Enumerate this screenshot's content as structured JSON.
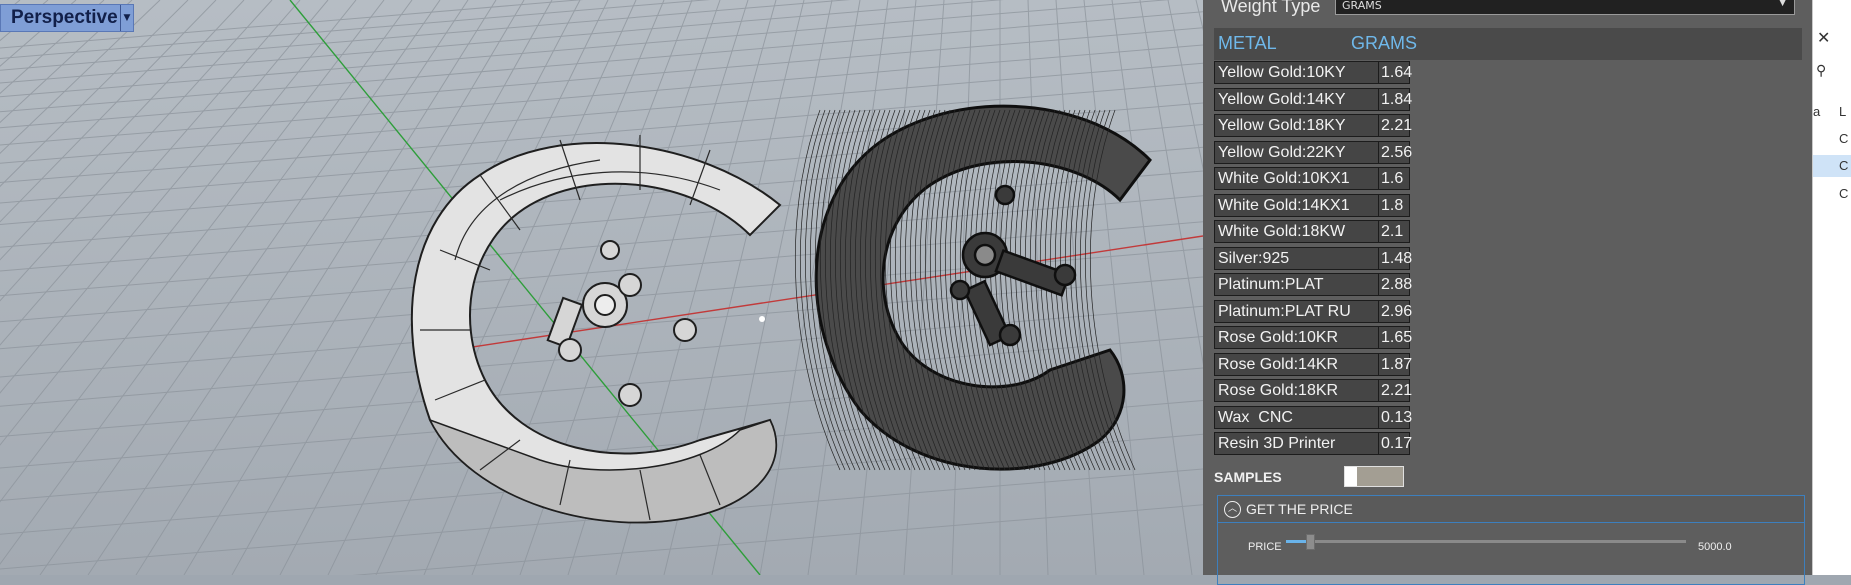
{
  "viewport": {
    "title": "Perspective",
    "background_color": "#aab1b9",
    "grid_color": "#8d949c",
    "x_axis_color": "#c23a3a",
    "y_axis_color": "#2e9e3a",
    "objects": [
      "render-mode-ring",
      "wireframe-ring"
    ]
  },
  "panel": {
    "weight_type_label": "Weight Type",
    "weight_type_value": "GRAMS",
    "header": {
      "metal": "METAL",
      "grams": "GRAMS"
    },
    "rows": [
      {
        "metal": "Yellow Gold:10KY",
        "grams": "1.64"
      },
      {
        "metal": "Yellow Gold:14KY",
        "grams": "1.84"
      },
      {
        "metal": "Yellow Gold:18KY",
        "grams": "2.21"
      },
      {
        "metal": "Yellow Gold:22KY",
        "grams": "2.56"
      },
      {
        "metal": "White Gold:10KX1",
        "grams": "1.6"
      },
      {
        "metal": "White Gold:14KX1",
        "grams": "1.8"
      },
      {
        "metal": "White Gold:18KW",
        "grams": "2.1"
      },
      {
        "metal": "Silver:925",
        "grams": "1.48"
      },
      {
        "metal": "Platinum:PLAT",
        "grams": "2.88"
      },
      {
        "metal": "Platinum:PLAT RU",
        "grams": "2.96"
      },
      {
        "metal": "Rose Gold:10KR",
        "grams": "1.65"
      },
      {
        "metal": "Rose Gold:14KR",
        "grams": "1.87"
      },
      {
        "metal": "Rose Gold:18KR",
        "grams": "2.21"
      },
      {
        "metal": "Wax  CNC",
        "grams": "0.13"
      },
      {
        "metal": "Resin 3D Printer",
        "grams": "0.17"
      }
    ],
    "samples_label": "SAMPLES",
    "samples_enabled": false,
    "price_section_title": "GET THE PRICE",
    "price_label": "PRICE",
    "price_max": "5000.0",
    "price_value_fraction": 0.05,
    "accent_color": "#6fb8ea"
  },
  "background_app": {
    "visible_letters": [
      "L",
      "C",
      "C",
      "C",
      "a"
    ]
  }
}
